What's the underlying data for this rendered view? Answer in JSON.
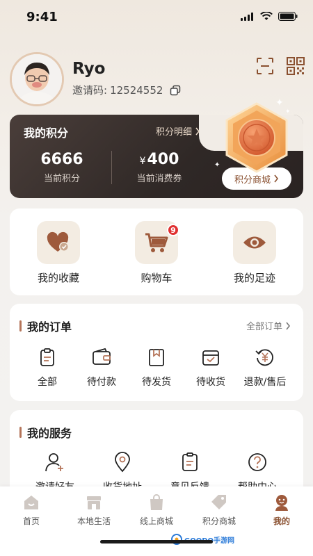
{
  "status": {
    "time": "9:41"
  },
  "profile": {
    "name": "Ryo",
    "invite_label": "邀请码:",
    "invite_code": "12524552"
  },
  "points": {
    "title": "我的积分",
    "detail_label": "积分明细",
    "current_points_value": "6666",
    "current_points_label": "当前积分",
    "voucher_currency": "¥",
    "voucher_value": "400",
    "voucher_label": "当前消费券",
    "mall_button": "积分商城"
  },
  "quick": [
    {
      "label": "我的收藏",
      "icon": "heart-check-icon"
    },
    {
      "label": "购物车",
      "icon": "cart-icon",
      "badge": "9"
    },
    {
      "label": "我的足迹",
      "icon": "eye-icon"
    }
  ],
  "orders": {
    "title": "我的订单",
    "all_label": "全部订单",
    "items": [
      {
        "label": "全部",
        "icon": "clipboard-icon"
      },
      {
        "label": "待付款",
        "icon": "wallet-icon"
      },
      {
        "label": "待发货",
        "icon": "package-icon"
      },
      {
        "label": "待收货",
        "icon": "box-check-icon"
      },
      {
        "label": "退款/售后",
        "icon": "refund-icon"
      }
    ]
  },
  "services": {
    "title": "我的服务",
    "items": [
      {
        "label": "邀请好友",
        "icon": "user-add-icon"
      },
      {
        "label": "收货地址",
        "icon": "location-icon"
      },
      {
        "label": "意见反馈",
        "icon": "feedback-icon"
      },
      {
        "label": "帮助中心",
        "icon": "help-icon"
      }
    ]
  },
  "nav": [
    {
      "label": "首页",
      "icon": "home-icon"
    },
    {
      "label": "本地生活",
      "icon": "shop-icon"
    },
    {
      "label": "线上商城",
      "icon": "bag-icon"
    },
    {
      "label": "积分商城",
      "icon": "tag-icon"
    },
    {
      "label": "我的",
      "icon": "profile-icon",
      "active": true
    }
  ],
  "watermark": {
    "text": "GOODO手游网"
  },
  "colors": {
    "accent": "#8a5030",
    "brand_brown": "#b5755a",
    "card_dark": "#2f2826",
    "badge_red": "#e03030"
  }
}
